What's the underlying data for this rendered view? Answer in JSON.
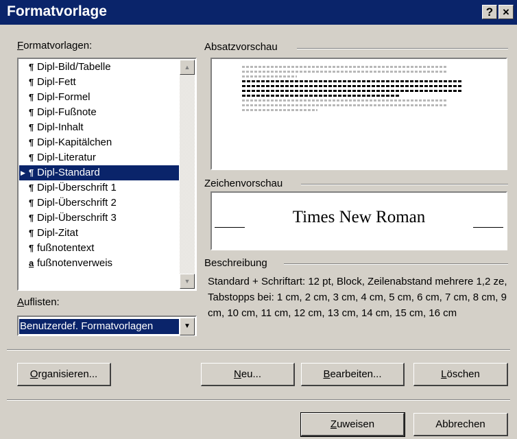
{
  "window": {
    "title": "Formatvorlage",
    "help_label": "?",
    "close_label": "×"
  },
  "styles": {
    "label": "Formatvorlagen:",
    "label_accel": "F",
    "label_rest": "ormatvorlagen:",
    "items": [
      {
        "mark": "¶",
        "label": "Dipl-Bild/Tabelle"
      },
      {
        "mark": "¶",
        "label": "Dipl-Fett"
      },
      {
        "mark": "¶",
        "label": "Dipl-Formel"
      },
      {
        "mark": "¶",
        "label": "Dipl-Fußnote"
      },
      {
        "mark": "¶",
        "label": "Dipl-Inhalt"
      },
      {
        "mark": "¶",
        "label": "Dipl-Kapitälchen"
      },
      {
        "mark": "¶",
        "label": "Dipl-Literatur"
      },
      {
        "mark": "¶",
        "label": "Dipl-Standard",
        "selected": true
      },
      {
        "mark": "¶",
        "label": "Dipl-Überschrift 1"
      },
      {
        "mark": "¶",
        "label": "Dipl-Überschrift 2"
      },
      {
        "mark": "¶",
        "label": "Dipl-Überschrift 3"
      },
      {
        "mark": "¶",
        "label": "Dipl-Zitat"
      },
      {
        "mark": "¶",
        "label": "fußnotentext"
      },
      {
        "mark": "a",
        "label": "fußnotenverweis"
      }
    ]
  },
  "list_filter": {
    "label_accel": "A",
    "label_rest": "uflisten:",
    "value": "Benutzerdef. Formatvorlagen"
  },
  "paragraph_preview": {
    "label": "Absatzvorschau"
  },
  "character_preview": {
    "label": "Zeichenvorschau",
    "sample": "Times New Roman"
  },
  "description": {
    "label": "Beschreibung",
    "text": "Standard + Schriftart: 12 pt, Block, Zeilenabstand mehrere 1,2 ze, Tabstopps bei: 1 cm, 2 cm, 3 cm, 4 cm, 5 cm, 6 cm, 7 cm, 8 cm, 9 cm, 10 cm, 11 cm, 12 cm, 13 cm, 14 cm, 15 cm, 16 cm"
  },
  "buttons": {
    "organize": {
      "accel": "O",
      "rest": "rganisieren..."
    },
    "new": {
      "accel": "N",
      "rest": "eu..."
    },
    "edit": {
      "accel": "B",
      "rest": "earbeiten..."
    },
    "delete": {
      "pre": "",
      "accel": "L",
      "rest": "öschen"
    },
    "apply": {
      "accel": "Z",
      "rest": "uweisen"
    },
    "cancel": {
      "label": "Abbrechen"
    }
  },
  "colors": {
    "titlebar": "#0a246a",
    "dialog": "#d4d0c8",
    "selection": "#0a246a"
  }
}
